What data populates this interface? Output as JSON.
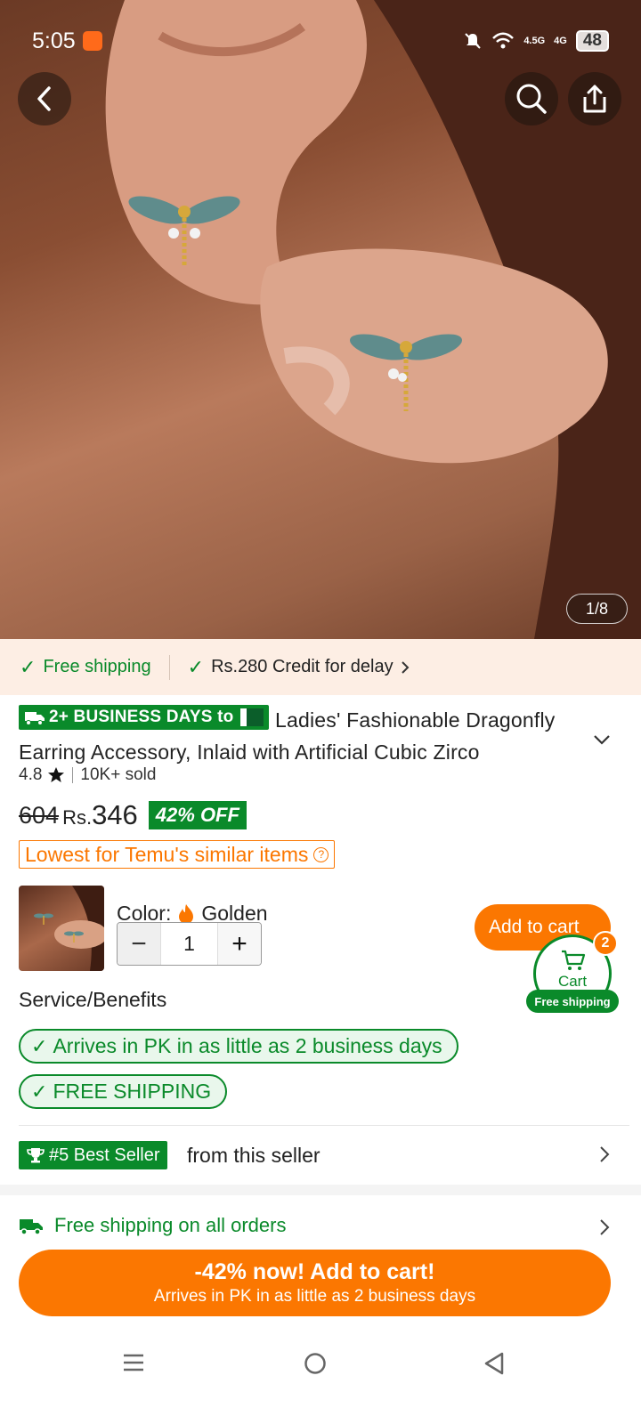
{
  "status_bar": {
    "time": "5:05",
    "network_1": "4.5G",
    "network_2": "4G",
    "battery": "48"
  },
  "gallery": {
    "counter": "1/8"
  },
  "shipping_strip": {
    "free_shipping": "Free shipping",
    "credit": "Rs.280 Credit for delay"
  },
  "title": {
    "badge": "2+ BUSINESS DAYS to",
    "line1": "Ladies' Fashionable Dragonfly",
    "line2": "Earring Accessory, Inlaid with Artificial Cubic Zirco"
  },
  "rating": {
    "score": "4.8",
    "sold": "10K+ sold"
  },
  "price": {
    "old": "604",
    "currency": "Rs.",
    "new": "346",
    "discount": "42% OFF"
  },
  "lowest_badge": "Lowest for Temu's similar items",
  "variant": {
    "color_label": "Color:",
    "color_value": "Golden",
    "quantity": "1",
    "minus": "−",
    "plus": "+"
  },
  "add_to_cart_small": "Add to cart",
  "cart": {
    "label": "Cart",
    "count": "2",
    "free_shipping": "Free shipping"
  },
  "service": {
    "title": "Service/Benefits",
    "pill1": "Arrives in PK in as little as 2 business days",
    "pill2": "FREE SHIPPING"
  },
  "best_seller": {
    "badge": "#5 Best Seller",
    "text": "from this seller"
  },
  "free_all": "Free shipping on all orders",
  "cta": {
    "line1": "-42% now! Add to cart!",
    "line2": "Arrives in PK in as little as 2 business days"
  },
  "colors": {
    "accent": "#fb7701",
    "green": "#0a8a2a"
  }
}
